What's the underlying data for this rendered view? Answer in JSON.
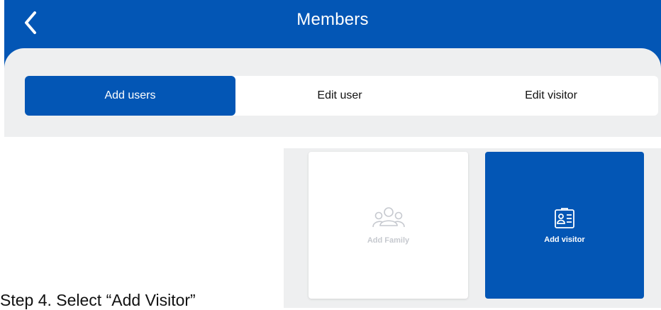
{
  "header": {
    "title": "Members",
    "back_icon": "chevron-left-icon"
  },
  "tabs": [
    {
      "label": "Add users",
      "active": true
    },
    {
      "label": "Edit user",
      "active": false
    },
    {
      "label": "Edit visitor",
      "active": false
    }
  ],
  "cards": {
    "family": {
      "label": "Add Family",
      "icon": "group-icon"
    },
    "visitor": {
      "label": "Add visitor",
      "icon": "id-card-icon"
    }
  },
  "caption": "Step 4. Select “Add Visitor”",
  "colors": {
    "primary": "#0356b5",
    "background": "#eeeff0",
    "inactive_text": "#c6c9cf"
  }
}
